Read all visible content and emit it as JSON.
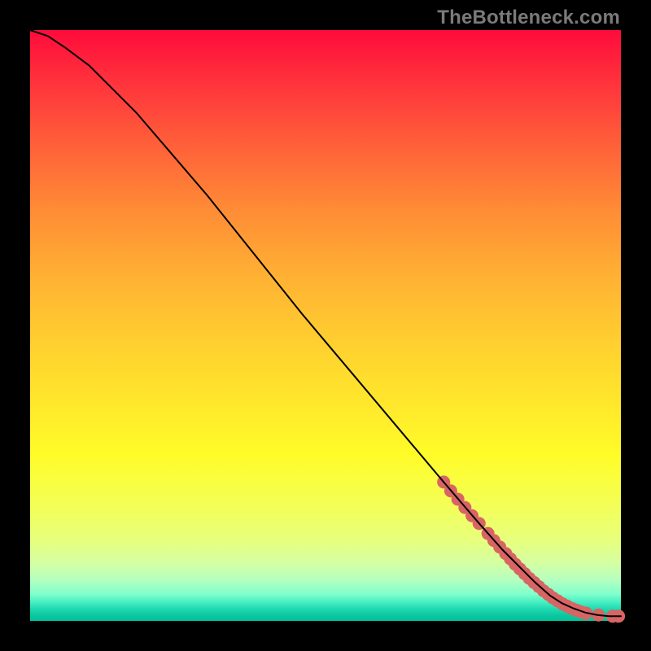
{
  "watermark": "TheBottleneck.com",
  "chart_data": {
    "type": "line",
    "title": "",
    "xlabel": "",
    "ylabel": "",
    "xlim": [
      0,
      100
    ],
    "ylim": [
      0,
      100
    ],
    "series": [
      {
        "name": "curve",
        "color": "#000000",
        "x": [
          0,
          3,
          6,
          10,
          14,
          18,
          24,
          30,
          38,
          46,
          54,
          62,
          70,
          76,
          80,
          83,
          85.5,
          88,
          90,
          92,
          94,
          96,
          98,
          100
        ],
        "y": [
          100,
          99,
          97,
          94,
          90,
          86,
          79,
          72,
          62,
          52,
          42.5,
          33,
          23.5,
          16.5,
          12,
          9,
          6.5,
          4.3,
          3.0,
          2.1,
          1.4,
          1.0,
          0.8,
          0.8
        ]
      }
    ],
    "highlight_points": {
      "name": "dots",
      "color": "#d86464",
      "radius_px": 8,
      "points": [
        {
          "x": 70.0,
          "y": 23.5
        },
        {
          "x": 71.2,
          "y": 22.0
        },
        {
          "x": 72.4,
          "y": 20.6
        },
        {
          "x": 73.6,
          "y": 19.2
        },
        {
          "x": 74.8,
          "y": 17.8
        },
        {
          "x": 76.0,
          "y": 16.5
        },
        {
          "x": 77.5,
          "y": 14.8
        },
        {
          "x": 78.5,
          "y": 13.6
        },
        {
          "x": 79.5,
          "y": 12.5
        },
        {
          "x": 80.5,
          "y": 11.4
        },
        {
          "x": 81.3,
          "y": 10.5
        },
        {
          "x": 82.1,
          "y": 9.6
        },
        {
          "x": 82.9,
          "y": 8.8
        },
        {
          "x": 83.7,
          "y": 8.0
        },
        {
          "x": 84.5,
          "y": 7.2
        },
        {
          "x": 85.3,
          "y": 6.5
        },
        {
          "x": 86.1,
          "y": 5.8
        },
        {
          "x": 86.9,
          "y": 5.1
        },
        {
          "x": 87.7,
          "y": 4.5
        },
        {
          "x": 88.5,
          "y": 3.9
        },
        {
          "x": 89.3,
          "y": 3.4
        },
        {
          "x": 90.1,
          "y": 2.9
        },
        {
          "x": 90.9,
          "y": 2.5
        },
        {
          "x": 91.7,
          "y": 2.1
        },
        {
          "x": 92.5,
          "y": 1.8
        },
        {
          "x": 93.3,
          "y": 1.5
        },
        {
          "x": 94.1,
          "y": 1.3
        },
        {
          "x": 96.2,
          "y": 1.0
        },
        {
          "x": 98.6,
          "y": 0.8
        },
        {
          "x": 99.6,
          "y": 0.8
        }
      ]
    }
  }
}
